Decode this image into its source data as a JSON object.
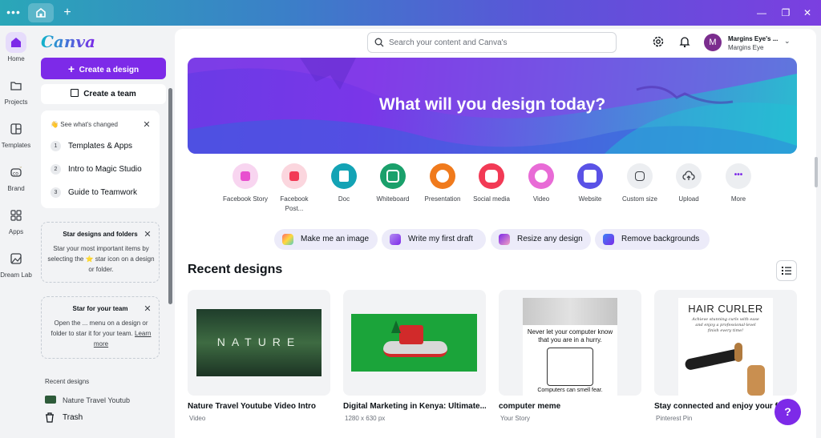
{
  "titlebar": {
    "menu_dots": "•••",
    "new_tab": "+",
    "minimize": "—",
    "restore": "❐",
    "close": "✕"
  },
  "rail": {
    "items": [
      {
        "label": "Home",
        "icon": "home-icon"
      },
      {
        "label": "Projects",
        "icon": "folder-icon"
      },
      {
        "label": "Templates",
        "icon": "templates-icon"
      },
      {
        "label": "Brand",
        "icon": "brand-icon"
      },
      {
        "label": "Apps",
        "icon": "apps-icon"
      },
      {
        "label": "Dream Lab",
        "icon": "dream-lab-icon"
      }
    ]
  },
  "panel": {
    "logo": "Canva",
    "create_design": "Create a design",
    "create_team": "Create a team",
    "changed": {
      "title": "See what's changed",
      "items": [
        "Templates & Apps",
        "Intro to Magic Studio",
        "Guide to Teamwork"
      ]
    },
    "star_card": {
      "title": "Star designs and folders",
      "body": "Star your most important items by selecting the ⭐ star icon on a design or folder."
    },
    "team_card": {
      "title": "Star for your team",
      "body": "Open the ... menu on a design or folder to star it for your team.",
      "link": "Learn more"
    },
    "recent_label": "Recent designs",
    "recent_item": "Nature Travel Youtub",
    "trash": "Trash"
  },
  "header": {
    "search_placeholder": "Search your content and Canva's",
    "account_name": "Margins Eye's ...",
    "account_sub": "Margins Eye",
    "avatar_letter": "M"
  },
  "hero": {
    "title": "What will you design today?"
  },
  "quick_actions": [
    {
      "label": "Facebook Story",
      "color": "#f8d5f0"
    },
    {
      "label": "Facebook Post...",
      "color": "#fbd6de"
    },
    {
      "label": "Doc",
      "color": "#13a3b5"
    },
    {
      "label": "Whiteboard",
      "color": "#1aa06b"
    },
    {
      "label": "Presentation",
      "color": "#f07a1c"
    },
    {
      "label": "Social media",
      "color": "#f23a55"
    },
    {
      "label": "Video",
      "color": "#e86bd6"
    },
    {
      "label": "Website",
      "color": "#5a52e6"
    },
    {
      "label": "Custom size",
      "color": "#eceef1"
    },
    {
      "label": "Upload",
      "color": "#eceef1"
    },
    {
      "label": "More",
      "color": "#eceef1"
    }
  ],
  "pills": [
    {
      "label": "Make me an image"
    },
    {
      "label": "Write my first draft"
    },
    {
      "label": "Resize any design"
    },
    {
      "label": "Remove backgrounds"
    }
  ],
  "recent": {
    "title": "Recent designs",
    "items": [
      {
        "title": "Nature Travel Youtube Video Intro",
        "sub": "Video",
        "thumb_text": "NATURE"
      },
      {
        "title": "Digital Marketing in Kenya: Ultimate...",
        "sub": "1280 x 630 px"
      },
      {
        "title": "computer  meme",
        "sub": "Your Story",
        "thumb_top": "Never let your computer know that you are in a hurry.",
        "thumb_bottom": "Computers can smell fear."
      },
      {
        "title": "Stay connected and enjoy your fa",
        "sub": "Pinterest Pin",
        "thumb_text": "HAIR CURLER",
        "thumb_small": "Achieve stunning curls with ease and enjoy a professional-level finish every time!"
      }
    ]
  },
  "help": "?"
}
